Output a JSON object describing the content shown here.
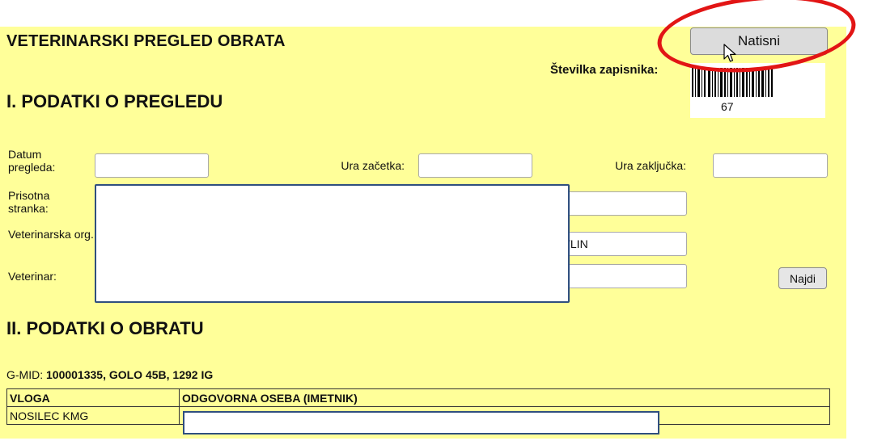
{
  "header": {
    "title": "VETERINARSKI PREGLED OBRATA",
    "print_label": "Natisni",
    "record_number_label": "Številka zapisnika:",
    "barcode_text": "67"
  },
  "section1": {
    "title": "I. PODATKI O PREGLEDU",
    "date_label": "Datum pregleda:",
    "date_value": "",
    "start_label": "Ura začetka:",
    "start_value": "",
    "end_label": "Ura zaključka:",
    "end_value": "",
    "party_label": "Prisotna stranka:",
    "party_value": "",
    "vet_org_label": "Veterinarska org.:",
    "vet_org_value": "STLIN",
    "vet_label": "Veterinar:",
    "vet_value": "",
    "find_label": "Najdi"
  },
  "section2": {
    "title": "II. PODATKI O OBRATU",
    "gmid_label": "G-MID:",
    "gmid_value": "100001335, GOLO 45B, 1292 IG",
    "columns": [
      "VLOGA",
      "ODGOVORNA OSEBA (IMETNIK)"
    ],
    "rows": [
      {
        "role": "NOSILEC KMG",
        "person": ""
      }
    ]
  },
  "colors": {
    "panel_background": "#ffff99",
    "highlight": "#e21515"
  },
  "icons": [
    "mouse-cursor-icon",
    "barcode-icon"
  ]
}
